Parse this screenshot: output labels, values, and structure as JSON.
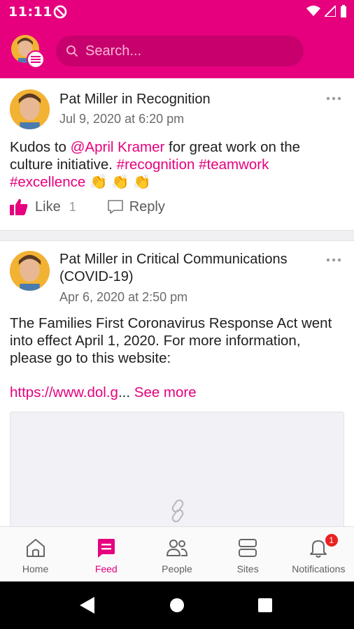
{
  "status_bar": {
    "time": "11:11"
  },
  "header": {
    "search_placeholder": "Search..."
  },
  "posts": [
    {
      "author": "Pat Miller in Recognition",
      "date": "Jul 9, 2020 at 6:20 pm",
      "body_prefix": "Kudos to ",
      "mention": "@April Kramer",
      "body_middle": " for great work on the culture initiative. ",
      "hashtag1": "#recognition",
      "hashtag2": "#teamwork",
      "hashtag3": "#excellence",
      "emojis": "👏 👏 👏",
      "like_label": "Like",
      "like_count": "1",
      "reply_label": "Reply"
    },
    {
      "author": "Pat Miller in Critical Communications (COVID-19)",
      "date": "Apr 6, 2020 at 2:50 pm",
      "body": "The Families First Coronavirus Response Act went into effect April 1, 2020. For more information, please go to this website:",
      "link": "https://www.dol.g",
      "ellipsis": "...",
      "see_more": "See more"
    }
  ],
  "bottom_nav": {
    "items": [
      {
        "label": "Home",
        "icon": "home-icon",
        "active": false
      },
      {
        "label": "Feed",
        "icon": "feed-icon",
        "active": true
      },
      {
        "label": "People",
        "icon": "people-icon",
        "active": false
      },
      {
        "label": "Sites",
        "icon": "sites-icon",
        "active": false
      },
      {
        "label": "Notifications",
        "icon": "bell-icon",
        "active": false
      }
    ],
    "notification_count": "1"
  },
  "colors": {
    "brand": "#e6007e",
    "badge": "#e8231f"
  }
}
